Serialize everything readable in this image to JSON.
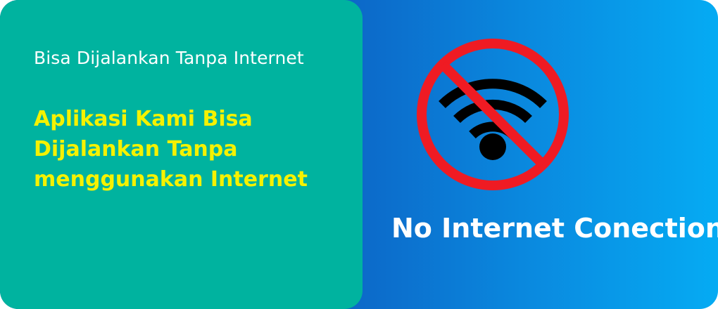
{
  "left": {
    "title": "Bisa Dijalankan Tanpa Internet",
    "description_lines": [
      "Aplikasi Kami Bisa",
      "Dijalankan Tanpa",
      "menggunakan Internet"
    ]
  },
  "right": {
    "icon": "no-wifi-icon",
    "caption": "No Internet Conection"
  },
  "colors": {
    "left_panel": "#00b39f",
    "description_text": "#f5f200",
    "prohibition_red": "#ef1b23",
    "gradient_start": "#0b3fa3",
    "gradient_end": "#05abf3"
  }
}
